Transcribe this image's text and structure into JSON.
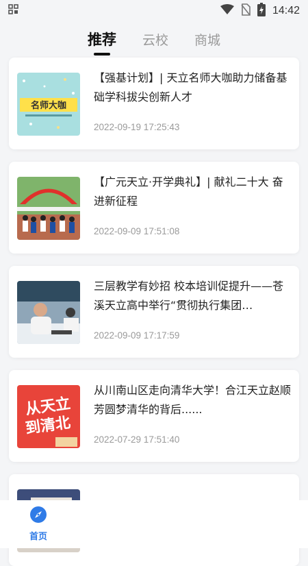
{
  "status_bar": {
    "time": "14:42"
  },
  "tabs": [
    {
      "label": "推荐",
      "active": true
    },
    {
      "label": "云校",
      "active": false
    },
    {
      "label": "商城",
      "active": false
    }
  ],
  "articles": [
    {
      "title": "【强基计划】| 天立名师大咖助力储备基础学科拔尖创新人才",
      "date": "2022-09-19 17:25:43",
      "thumb_text": "名师大咖"
    },
    {
      "title": "【广元天立·开学典礼】| 献礼二十大 奋进新征程",
      "date": "2022-09-09 17:51:08"
    },
    {
      "title": "三层教学有妙招  校本培训促提升——苍溪天立高中举行“贯彻执行集团…",
      "date": "2022-09-09 17:17:59"
    },
    {
      "title": "从川南山区走向清华大学！合江天立赵顺芳圆梦清华的背后......",
      "date": "2022-07-29 17:51:40",
      "thumb_text_line1": "从天立",
      "thumb_text_line2": "到清北"
    }
  ],
  "bottom_nav": {
    "home_label": "首页",
    "accent": "#2f7be7"
  }
}
